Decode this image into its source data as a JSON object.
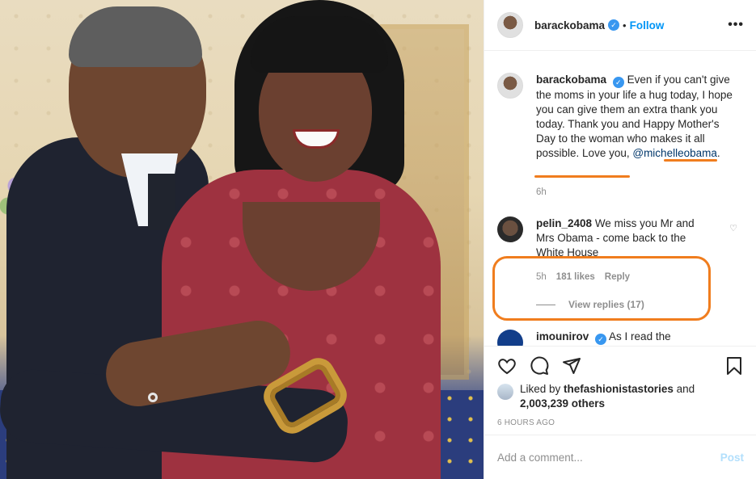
{
  "author": {
    "username": "barackobama",
    "verified_mark": "✓",
    "dot": "•",
    "follow_label": "Follow",
    "more_label": "•••"
  },
  "caption": {
    "username": "barackobama",
    "text_main": "Even if you can't give the moms in your life a hug today, I hope you can give them an extra thank you today. Thank you and Happy Mother's Day to the woman who makes it all possible. ",
    "text_love": "Love you,",
    "mention": "@michelleobama",
    "period": ".",
    "time": "6h"
  },
  "comments": [
    {
      "username": "pelin_2408",
      "text": "We miss you Mr and Mrs Obama - come back to the White House",
      "time": "5h",
      "likes": "181 likes",
      "reply_label": "Reply",
      "view_replies": "View replies (17)"
    },
    {
      "username": "imounirov",
      "text": "As I read the"
    }
  ],
  "likes": {
    "prefix": "Liked by ",
    "user": "thefashionistastories",
    "and": " and",
    "count": "2,003,239 others"
  },
  "timestamp": "6 HOURS AGO",
  "composer": {
    "placeholder": "Add a comment...",
    "post_label": "Post"
  },
  "icons": {
    "like": "heart-icon",
    "comment": "comment-icon",
    "share": "paper-plane-icon",
    "save": "bookmark-icon"
  },
  "colors": {
    "accent": "#0095f6",
    "annotation": "#f07d1e"
  }
}
